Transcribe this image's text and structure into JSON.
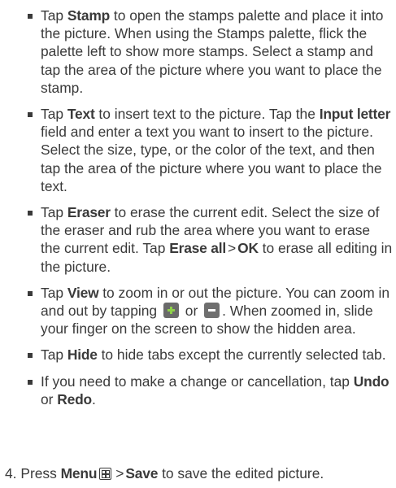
{
  "bullets": [
    {
      "parts": {
        "t1": "Tap ",
        "b1": "Stamp",
        "t2": " to open the stamps palette and place it into the picture. When using the Stamps palette, flick the palette left to show more stamps.  Select a stamp and tap the area of the picture where you want to place the stamp."
      }
    },
    {
      "parts": {
        "t1": "Tap ",
        "b1": "Text",
        "t2": " to insert text to the picture. Tap the ",
        "b2": "Input letter",
        "t3": " field and enter a text you want to insert to the picture. Select the size, type, or the color of the text, and then tap the area of the picture where you want to place the text."
      }
    },
    {
      "parts": {
        "t1": "Tap ",
        "b1": "Eraser",
        "t2": " to erase the current edit. Select the size of the eraser and rub the area where you want to erase the current edit. Tap ",
        "b2": "Erase all",
        "sep": ">",
        "b3": "OK",
        "t3": " to erase all editing in the picture."
      }
    },
    {
      "parts": {
        "t1": "Tap ",
        "b1": "View",
        "t2": " to zoom in or out the picture. You can zoom in and out by tapping ",
        "t3": " or ",
        "t4": ". When zoomed in, slide your finger on the screen to show the hidden area."
      },
      "icons": [
        "zoom-in-plus",
        "zoom-out-minus"
      ]
    },
    {
      "parts": {
        "t1": "Tap ",
        "b1": "Hide",
        "t2": " to hide tabs except the currently selected tab."
      }
    },
    {
      "parts": {
        "t1": "If you need to make a change or cancellation, tap ",
        "b1": "Undo",
        "t2": " or ",
        "b2": "Redo",
        "t3": "."
      }
    }
  ],
  "step": {
    "number": "4.",
    "t1": " Press ",
    "b1": "Menu",
    "icon": "menu-grid",
    "sep": ">",
    "b2": "Save",
    "t2": " to save the edited picture."
  },
  "colors": {
    "text": "#3a3a3a",
    "icon_bg": "#6f6f6f",
    "plus_accent": "#8ed14a"
  }
}
